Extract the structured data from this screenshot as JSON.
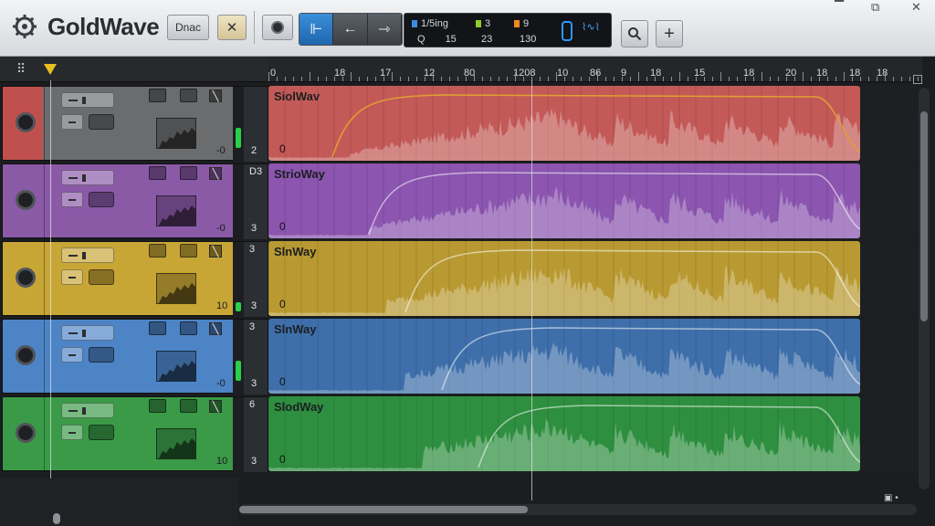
{
  "app": {
    "title": "GoldWave",
    "logo_icon": "gear-logo-icon"
  },
  "toolbar": {
    "mode_label": "Dnac",
    "close_label": "✕",
    "transport": [
      {
        "icon": "start-marker-icon",
        "glyph": "⊩",
        "active": true
      },
      {
        "icon": "rewind-arrow-icon",
        "glyph": "←",
        "active": false
      },
      {
        "icon": "forward-arrow-icon",
        "glyph": "⇾",
        "active": false
      }
    ],
    "display": {
      "col1_top": "1/5ing",
      "col1_bottom": "15",
      "col2_top": "3",
      "col2_bottom": "23",
      "col3_top": "9",
      "col3_bottom": "130",
      "q_label": "Q",
      "colors": {
        "blue": "#3a8ee0",
        "green": "#8ecb2d",
        "orange": "#ef8a1e"
      }
    }
  },
  "ruler": {
    "labels": [
      "0",
      "18",
      "17",
      "12",
      "80",
      "1208",
      "10",
      "86",
      "9",
      "18",
      "15",
      "18",
      "20",
      "18",
      "18",
      "18"
    ]
  },
  "tracks": [
    {
      "name": "SiolWav",
      "zero": "0",
      "vol": "-0",
      "meter_top": "",
      "meter_bot": "2",
      "color": "#c35a58",
      "head_color": "#6f6f6f",
      "level": 0.45
    },
    {
      "name": "StrioWay",
      "zero": "0",
      "vol": "-0",
      "meter_top": "D3",
      "meter_bot": "3",
      "color": "#8b55b0",
      "head_color": "#8a5aa7",
      "level": 0.0
    },
    {
      "name": "SlnWay",
      "zero": "0",
      "vol": "10",
      "meter_top": "3",
      "meter_bot": "3",
      "color": "#b99a32",
      "head_color": "#c7a636",
      "level": 0.2
    },
    {
      "name": "SlnWay",
      "zero": "0",
      "vol": "-0",
      "meter_top": "3",
      "meter_bot": "3",
      "color": "#3e6faa",
      "head_color": "#4d84c6",
      "level": 0.45
    },
    {
      "name": "SlodWay",
      "zero": "0",
      "vol": "10",
      "meter_top": "6",
      "meter_bot": "3",
      "color": "#2f8f40",
      "head_color": "#3a9a48",
      "level": 0.0
    }
  ],
  "colors": {
    "accent": "#2f95ff",
    "playhead": "#e5c020",
    "meter": "#2bd04a"
  }
}
